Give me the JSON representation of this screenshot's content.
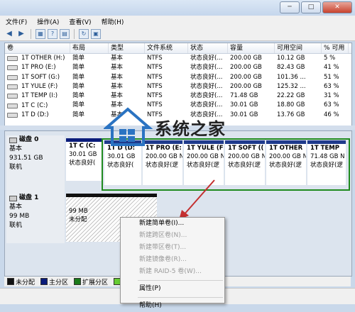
{
  "window": {
    "minimize": "─",
    "maximize": "□",
    "close": "✕"
  },
  "menu": [
    "文件(F)",
    "操作(A)",
    "查看(V)",
    "帮助(H)"
  ],
  "columns": [
    "卷",
    "布局",
    "类型",
    "文件系统",
    "状态",
    "容量",
    "可用空间",
    "% 可用"
  ],
  "volumes": [
    [
      "1T OTHER (H:)",
      "简单",
      "基本",
      "NTFS",
      "状态良好(...",
      "200.00 GB",
      "10.12 GB",
      "5 %"
    ],
    [
      "1T PRO (E:)",
      "简单",
      "基本",
      "NTFS",
      "状态良好(...",
      "200.00 GB",
      "82.43 GB",
      "41 %"
    ],
    [
      "1T SOFT (G:)",
      "简单",
      "基本",
      "NTFS",
      "状态良好(...",
      "200.00 GB",
      "101.36 ...",
      "51 %"
    ],
    [
      "1T YULE (F:)",
      "简单",
      "基本",
      "NTFS",
      "状态良好(...",
      "200.00 GB",
      "125.32 ...",
      "63 %"
    ],
    [
      "1T TEMP (I:)",
      "简单",
      "基本",
      "NTFS",
      "状态良好(...",
      "71.48 GB",
      "22.22 GB",
      "31 %"
    ],
    [
      "1T C (C:)",
      "简单",
      "基本",
      "NTFS",
      "状态良好(...",
      "30.01 GB",
      "18.80 GB",
      "63 %"
    ],
    [
      "1T D (D:)",
      "简单",
      "基本",
      "NTFS",
      "状态良好(...",
      "30.01 GB",
      "13.76 GB",
      "46 %"
    ]
  ],
  "disk0": {
    "name": "磁盘 0",
    "type": "基本",
    "size": "931.51 GB",
    "status": "联机",
    "partitions": [
      {
        "name": "1T C  (C:",
        "size": "30.01 GB",
        "status": "状态良好("
      },
      {
        "name": "1T D  (D:",
        "size": "30.01 GB",
        "status": "状态良好("
      },
      {
        "name": "1T PRO  (E:",
        "size": "200.00 GB N",
        "status": "状态良好(逻"
      },
      {
        "name": "1T YULE  (F:",
        "size": "200.00 GB N",
        "status": "状态良好(逻"
      },
      {
        "name": "1T SOFT  ((",
        "size": "200.00 GB N",
        "status": "状态良好(逻"
      },
      {
        "name": "1T OTHER",
        "size": "200.00 GB N",
        "status": "状态良好(逻"
      },
      {
        "name": "1T TEMP",
        "size": "71.48 GB N",
        "status": "状态良好(逻"
      }
    ]
  },
  "disk1": {
    "name": "磁盘 1",
    "type": "基本",
    "size": "99 MB",
    "status": "联机",
    "unallocated": {
      "size": "99 MB",
      "label": "未分配"
    }
  },
  "context_menu": {
    "items": [
      {
        "label": "新建简单卷(I)...",
        "disabled": false
      },
      {
        "label": "新建跨区卷(N)...",
        "disabled": true
      },
      {
        "label": "新建带区卷(T)...",
        "disabled": true
      },
      {
        "label": "新建镜像卷(R)...",
        "disabled": true
      },
      {
        "label": "新建 RAID-5 卷(W)...",
        "disabled": true
      },
      {
        "label": "属性(P)",
        "disabled": false
      },
      {
        "label": "帮助(H)",
        "disabled": false
      }
    ]
  },
  "legend": [
    {
      "label": "未分配",
      "color": "#111111"
    },
    {
      "label": "主分区",
      "color": "#0a1c7a"
    },
    {
      "label": "扩展分区",
      "color": "#1a7a1a"
    },
    {
      "label": "可用",
      "color": "#66cc33"
    }
  ],
  "watermark": {
    "title": "系统之家"
  },
  "colors": {
    "partition_bar": "#0a1c7a",
    "highlight_box": "#1f8a1f",
    "arrow": "#c43030"
  }
}
